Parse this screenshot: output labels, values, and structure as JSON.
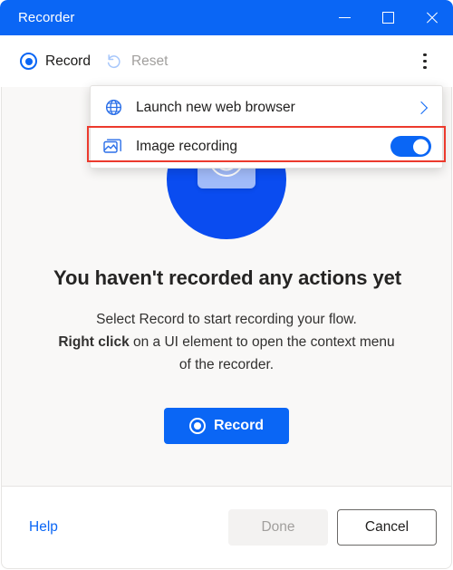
{
  "window": {
    "title": "Recorder",
    "caption": {
      "minimize": "minimize",
      "maximize": "maximize",
      "close": "close"
    },
    "accent_color": "#0a66f5",
    "body_background": "#f9f8f7",
    "highlight_color": "#ec3a2d"
  },
  "toolbar": {
    "record_label": "Record",
    "reset_label": "Reset",
    "reset_disabled": true,
    "more_label": "More commands"
  },
  "menu": {
    "items": [
      {
        "label": "Launch new web browser",
        "icon": "globe-icon",
        "accessory": "chevron-right-icon"
      },
      {
        "label": "Image recording",
        "icon": "image-icon",
        "accessory": "toggle-switch",
        "toggle_on": true,
        "highlighted": true
      }
    ]
  },
  "empty_state": {
    "illustration": "record-illustration",
    "title": "You haven't recorded any actions yet",
    "description_line_1": "Select Record to start recording your flow.",
    "description_bold": "Right click",
    "description_line_2": " on a UI element to open the context menu of the recorder.",
    "record_button_label": "Record"
  },
  "footer": {
    "help_label": "Help",
    "done_label": "Done",
    "done_disabled": true,
    "cancel_label": "Cancel"
  }
}
